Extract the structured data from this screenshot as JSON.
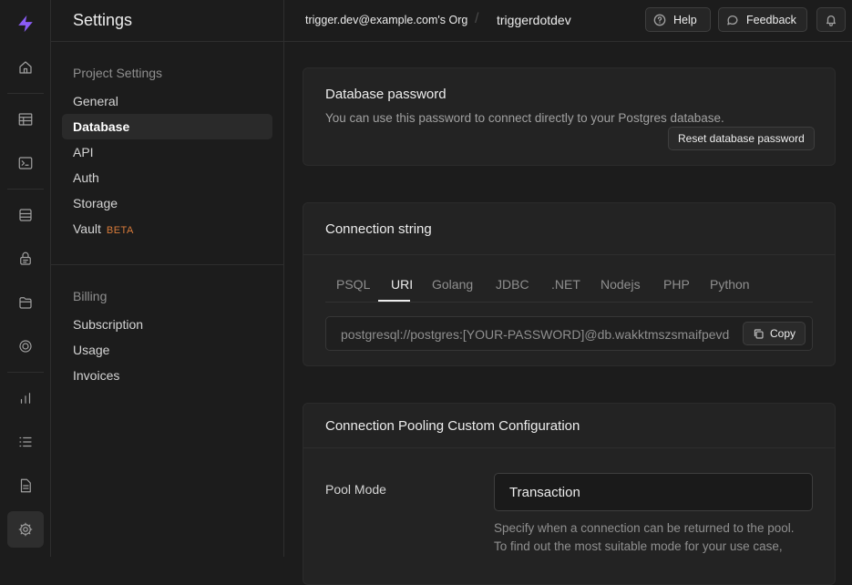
{
  "app": {
    "brand_color": "#8b5cf6",
    "rail_icons": [
      "home-icon",
      "table-editor-icon",
      "sql-editor-icon",
      "database-icon",
      "auth-lock-icon",
      "storage-icon",
      "realtime-icon",
      "reports-icon",
      "logs-icon",
      "docs-icon",
      "settings-icon"
    ]
  },
  "sidebar": {
    "title": "Settings",
    "project_group": {
      "title": "Project Settings",
      "items": [
        {
          "label": "General"
        },
        {
          "label": "Database",
          "active": true
        },
        {
          "label": "API"
        },
        {
          "label": "Auth"
        },
        {
          "label": "Storage"
        },
        {
          "label": "Vault",
          "badge": "BETA"
        }
      ]
    },
    "billing_group": {
      "title": "Billing",
      "items": [
        {
          "label": "Subscription"
        },
        {
          "label": "Usage"
        },
        {
          "label": "Invoices"
        }
      ]
    }
  },
  "topbar": {
    "org": "trigger.dev@example.com's Org",
    "separator": "/",
    "project": "triggerdotdev",
    "help_label": "Help",
    "feedback_label": "Feedback"
  },
  "db_password": {
    "title": "Database password",
    "description": "You can use this password to connect directly to your Postgres database.",
    "reset_label": "Reset database password"
  },
  "connection": {
    "title": "Connection string",
    "tabs": [
      "PSQL",
      "URI",
      "Golang",
      "JDBC",
      ".NET",
      "Nodejs",
      "PHP",
      "Python"
    ],
    "active_tab": "URI",
    "value": "postgresql://postgres:[YOUR-PASSWORD]@db.wakktmszsmaifpevdsg",
    "copy_label": "Copy"
  },
  "pooling": {
    "title": "Connection Pooling Custom Configuration",
    "pool_mode_label": "Pool Mode",
    "pool_mode_value": "Transaction",
    "help_line1": "Specify when a connection can be returned to the pool.",
    "help_line2": "To find out the most suitable mode for your use case,"
  }
}
